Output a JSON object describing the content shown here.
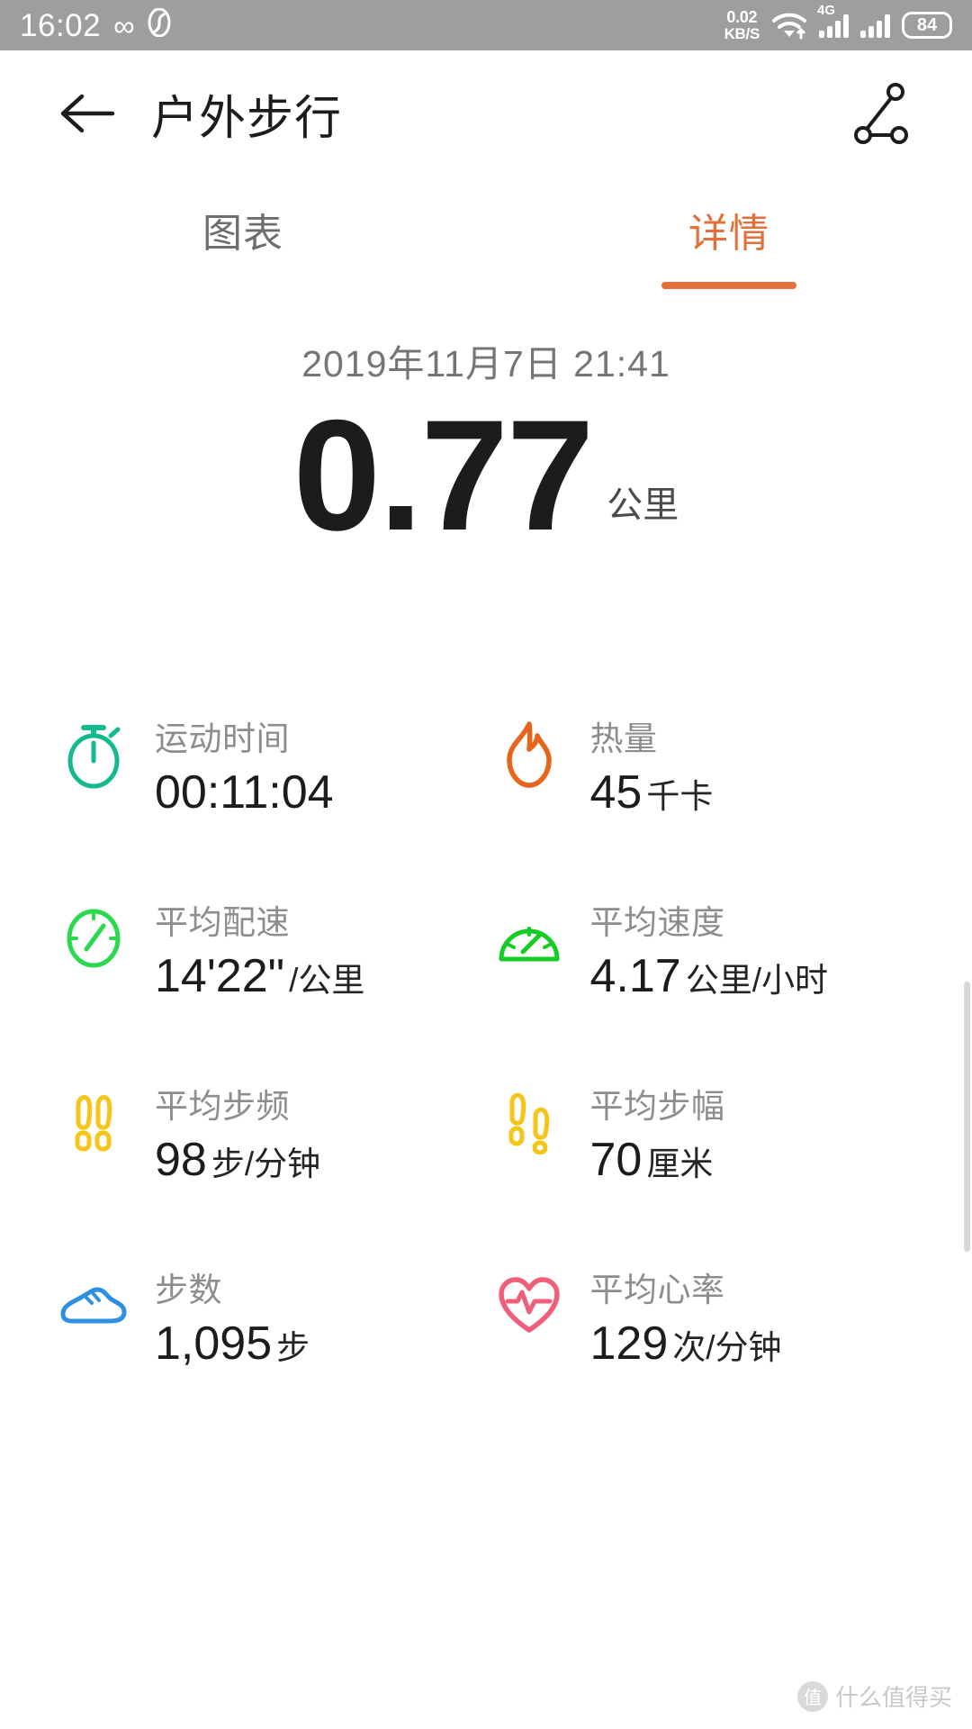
{
  "statusbar": {
    "time": "16:02",
    "infinity_icon": "∞",
    "app_glyph": "S",
    "network_rate": "0.02",
    "network_unit": "KB/S",
    "signal_4g": "4G",
    "battery": "84"
  },
  "appbar": {
    "back_icon": "back-arrow",
    "title": "户外步行",
    "share_icon": "share-nodes"
  },
  "tabs": [
    {
      "label": "图表",
      "active": false
    },
    {
      "label": "详情",
      "active": true
    }
  ],
  "hero": {
    "date": "2019年11月7日 21:41",
    "value": "0.77",
    "unit": "公里"
  },
  "stats": [
    {
      "icon": "stopwatch-icon",
      "label": "运动时间",
      "value": "00:11:04",
      "unit": "",
      "color": "#12bb8e"
    },
    {
      "icon": "flame-icon",
      "label": "热量",
      "value": "45",
      "unit": "千卡",
      "color": "#e8641a"
    },
    {
      "icon": "pace-gauge-icon",
      "label": "平均配速",
      "value": "14'22\"",
      "unit": "/公里",
      "color": "#2ad94e"
    },
    {
      "icon": "speed-gauge-icon",
      "label": "平均速度",
      "value": "4.17",
      "unit": "公里/小时",
      "color": "#14cc22"
    },
    {
      "icon": "footsteps-icon",
      "label": "平均步频",
      "value": "98",
      "unit": "步/分钟",
      "color": "#f5c518"
    },
    {
      "icon": "stride-icon",
      "label": "平均步幅",
      "value": "70",
      "unit": "厘米",
      "color": "#f5c518"
    },
    {
      "icon": "shoe-icon",
      "label": "步数",
      "value": "1,095",
      "unit": "步",
      "color": "#2f8fe0"
    },
    {
      "icon": "heart-pulse-icon",
      "label": "平均心率",
      "value": "129",
      "unit": "次/分钟",
      "color": "#ef5f7a"
    }
  ],
  "watermark": {
    "text": "什么值得买",
    "badge": "值"
  },
  "theme": {
    "accent": "#e2703a",
    "statusbar_bg": "#9e9e9e",
    "text_primary": "#1c1c1c",
    "text_muted": "#8d8d8d"
  }
}
